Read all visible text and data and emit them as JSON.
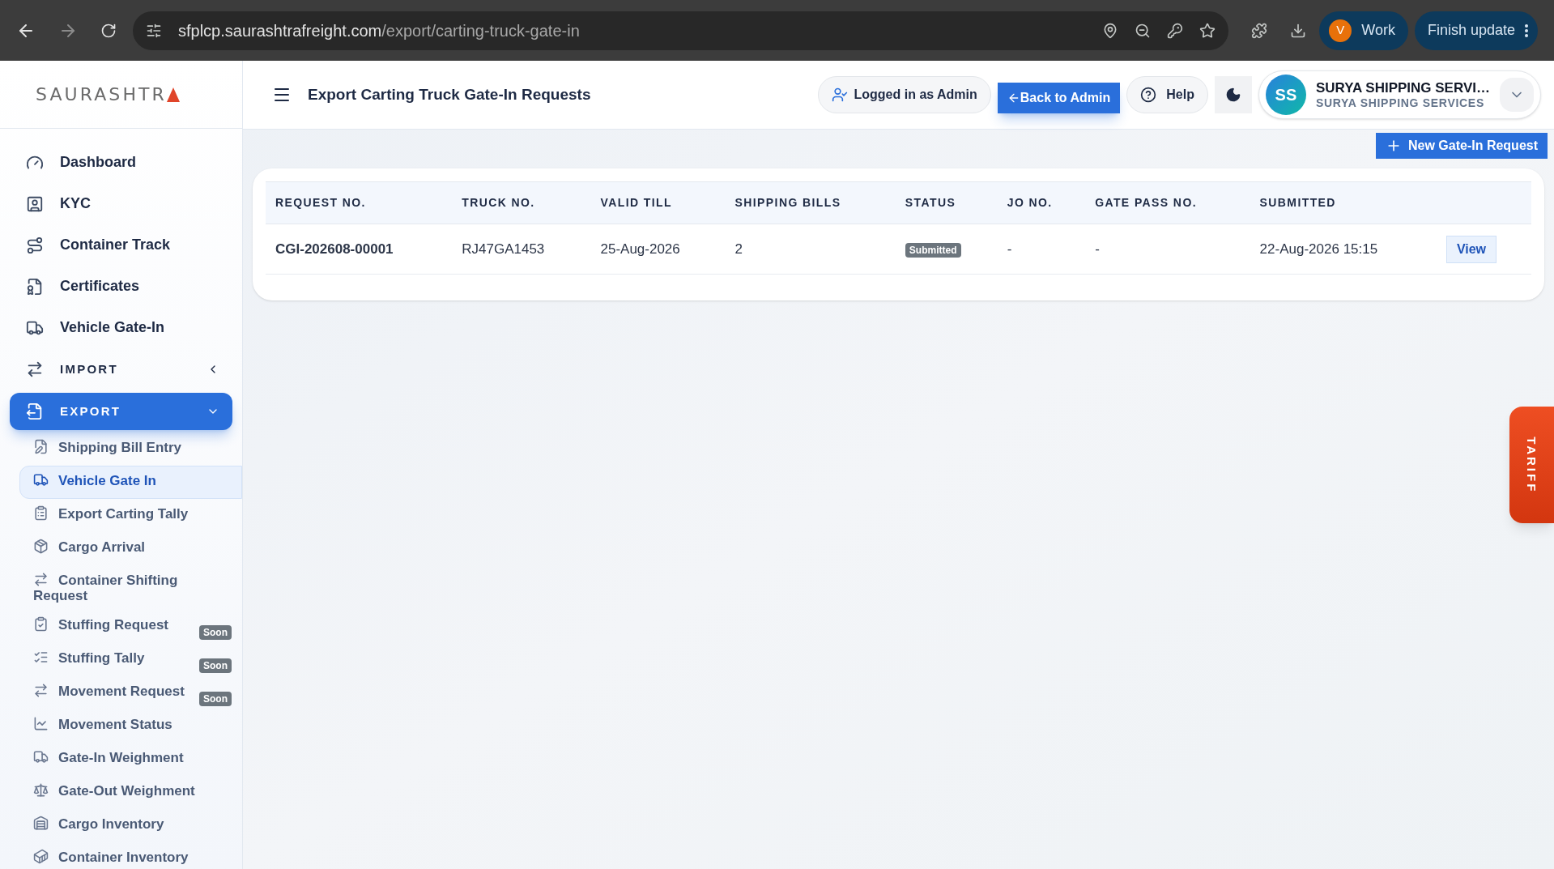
{
  "browser": {
    "url_host": "sfplcp.saurashtrafreight.com",
    "url_path": "/export/carting-truck-gate-in",
    "profile": {
      "initial": "V",
      "label": "Work"
    },
    "update_button": "Finish update"
  },
  "sidebar": {
    "logo": "SAURASHTR",
    "items": [
      {
        "kind": "link",
        "label": "Dashboard"
      },
      {
        "kind": "link",
        "label": "KYC"
      },
      {
        "kind": "link",
        "label": "Container Track"
      },
      {
        "kind": "link",
        "label": "Certificates"
      },
      {
        "kind": "link",
        "label": "Vehicle Gate-In"
      },
      {
        "kind": "section",
        "label": "IMPORT",
        "expanded": false,
        "selected": false
      },
      {
        "kind": "section",
        "label": "EXPORT",
        "expanded": true,
        "selected": true,
        "children": [
          {
            "label": "Shipping Bill Entry",
            "selected": false
          },
          {
            "label": "Vehicle Gate In",
            "selected": true
          },
          {
            "label": "Export Carting Tally",
            "selected": false
          },
          {
            "label": "Cargo Arrival",
            "selected": false
          },
          {
            "label": "Container Shifting Request",
            "selected": false
          },
          {
            "label": "Stuffing Request",
            "selected": false,
            "badge": "Soon"
          },
          {
            "label": "Stuffing Tally",
            "selected": false,
            "badge": "Soon"
          },
          {
            "label": "Movement Request",
            "selected": false,
            "badge": "Soon"
          },
          {
            "label": "Movement Status",
            "selected": false
          },
          {
            "label": "Gate-In Weighment",
            "selected": false
          },
          {
            "label": "Gate-Out Weighment",
            "selected": false
          },
          {
            "label": "Cargo Inventory",
            "selected": false
          },
          {
            "label": "Container Inventory",
            "selected": false
          }
        ]
      }
    ]
  },
  "header": {
    "title": "Export Carting Truck Gate-In Requests",
    "logged_in": "Logged in as Admin",
    "back_button": "Back to Admin",
    "help_button": "Help",
    "user": {
      "initials": "SS",
      "name": "SURYA SHIPPING SERVI…",
      "company": "SURYA SHIPPING SERVICES"
    }
  },
  "new_button": "New Gate-In Request",
  "table": {
    "columns": [
      "REQUEST NO.",
      "TRUCK NO.",
      "VALID TILL",
      "SHIPPING BILLS",
      "STATUS",
      "JO NO.",
      "GATE PASS NO.",
      "SUBMITTED"
    ],
    "rows": [
      {
        "request_no": "CGI-202608-00001",
        "truck_no": "RJ47GA1453",
        "valid_till": "25-Aug-2026",
        "shipping_bills": "2",
        "status": "Submitted",
        "jo_no": "-",
        "gate_pass_no": "-",
        "submitted": "22-Aug-2026 15:15",
        "action": "View"
      }
    ]
  },
  "tariff_tab": "TARIFF"
}
